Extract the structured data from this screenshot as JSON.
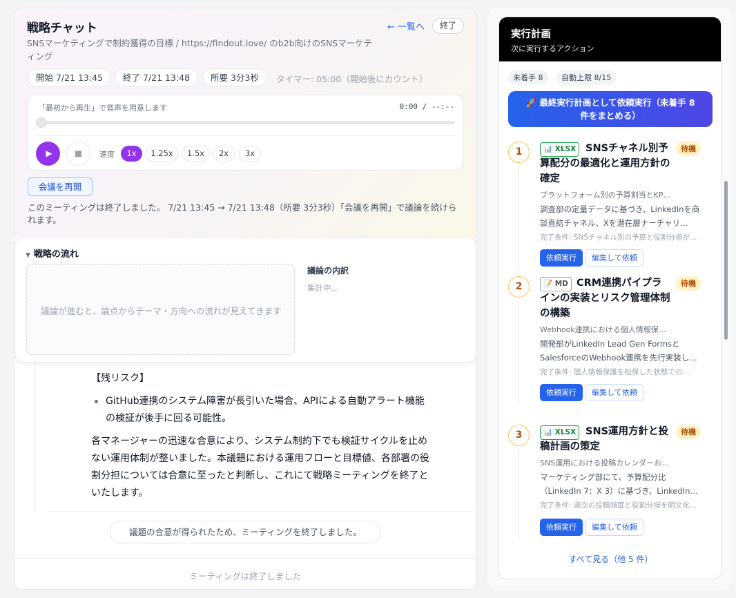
{
  "chat": {
    "title": "戦略チャット",
    "back_label": "← 一覧へ",
    "end_label": "終了",
    "subtitle": "SNSマーケティングで制約獲得の目標 / https://findout.love/ のb2b向けのSNSマーケティング",
    "start_chip": "開始 7/21 13:45",
    "end_chip": "終了 7/21 13:48",
    "duration_chip": "所要 3分3秒",
    "timer_text": "タイマー: 05:00（開始後にカウント）"
  },
  "audio": {
    "hint": "「最初から再生」で音声を用意します",
    "time": "0:00 / --:--",
    "progress": 0,
    "speed_label": "速度",
    "speeds": [
      "1x",
      "1.25x",
      "1.5x",
      "2x",
      "3x"
    ],
    "selected_speed": "1x"
  },
  "resume_label": "会議を再開",
  "ended_message": "このミーティングは終了しました。 7/21 13:45 → 7/21 13:48（所要 3分3秒）「会議を再開」で議論を続けられます。",
  "flow": {
    "toggle_label": "戦略の流れ",
    "placeholder": "議論が進むと、論点からテーマ・方向への流れが見えてきます",
    "breakdown_title": "議論の内訳",
    "breakdown_status": "集計中…"
  },
  "message": {
    "risk_heading": "【残リスク】",
    "bullet": "GitHub連携のシステム障害が長引いた場合、APIによる自動アラート機能の検証が後手に回る可能性。",
    "closing": "各マネージャーの迅速な合意により、システム制約下でも検証サイクルを止めない運用体制が整いました。本議題における運用フローと目標値、各部署の役割分担については合意に至ったと判断し、これにて戦略ミーティングを終了といたします。"
  },
  "system_message": "議題の合意が得られたため、ミーティングを終了しました。",
  "footer": "ミーティングは終了しました",
  "plan": {
    "title": "実行計画",
    "subtitle": "次に実行するアクション",
    "unstarted_chip": "未着手 8",
    "auto_limit_chip": "自動上限 8/15",
    "run_all_label": "🚀 最終実行計画として依頼実行（未着手 8 件をまとめる）",
    "run_label": "依頼実行",
    "edit_label": "編集して依頼",
    "wait_label": "待機",
    "see_all": "すべて見る（他 5 件）",
    "tasks": [
      {
        "num": "1",
        "type": "📊 XLSX",
        "title": "SNSチャネル別予算配分の最適化と運用方針の確定",
        "sub": "プラットフォーム別の予算割当とKP…",
        "desc": "調査部の定量データに基づき、LinkedInを商談直結チャネル、Xを潜在層ナーチャリ…",
        "cond": "完了条件: SNSチャネル別の予算と役割分担が…"
      },
      {
        "num": "2",
        "type": "📝 MD",
        "title": "CRM連携パイプラインの実装とリスク管理体制の構築",
        "sub": "Webhook連携における個人情報保…",
        "desc": "開発部がLinkedIn Lead Gen FormsとSalesforceのWebhook連携を先行実装し…",
        "cond": "完了条件: 個人情報保護を担保した状態での…"
      },
      {
        "num": "3",
        "type": "📊 XLSX",
        "title": "SNS運用方針と投稿計画の策定",
        "sub": "SNS運用における投稿カレンダーお…",
        "desc": "マーケティング部にて、予算配分比（LinkedIn 7：X 3）に基づき、LinkedIn…",
        "cond": "完了条件: 週次の投稿頻度と役割分担を明文化…"
      }
    ]
  }
}
